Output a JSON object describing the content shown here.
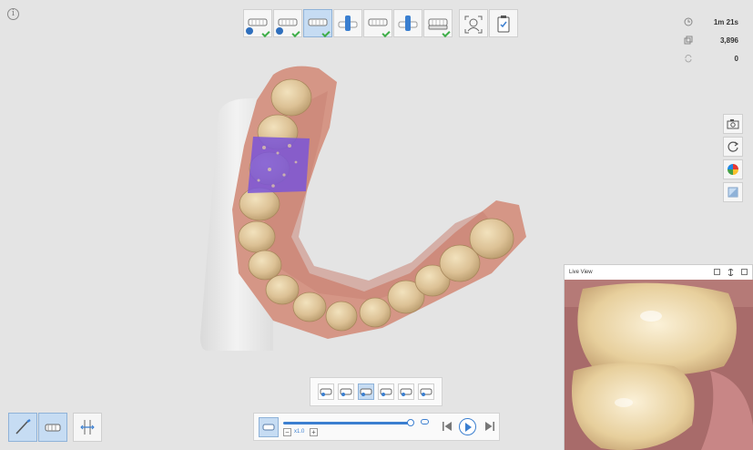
{
  "info": {
    "icon": "info-icon",
    "glyph": "i"
  },
  "stages": [
    {
      "name": "stage-maxilla-prep",
      "icon": "upper-jaw-icon",
      "done": true,
      "badge": true,
      "active": false
    },
    {
      "name": "stage-maxilla",
      "icon": "upper-jaw-icon",
      "done": true,
      "badge": true,
      "active": false
    },
    {
      "name": "stage-mandible",
      "icon": "lower-jaw-icon",
      "done": true,
      "badge": false,
      "active": true
    },
    {
      "name": "stage-scanbody-upper",
      "icon": "scanbody-icon",
      "done": false,
      "badge": false,
      "active": false
    },
    {
      "name": "stage-mandible-2",
      "icon": "lower-jaw-icon",
      "done": true,
      "badge": false,
      "active": false
    },
    {
      "name": "stage-scanbody-lower",
      "icon": "scanbody-icon",
      "done": false,
      "badge": false,
      "active": false
    },
    {
      "name": "stage-occlusion",
      "icon": "bite-icon",
      "done": true,
      "badge": false,
      "active": false
    },
    {
      "name": "stage-face-scan",
      "icon": "face-scan-icon",
      "done": false,
      "badge": false,
      "active": false
    },
    {
      "name": "stage-review",
      "icon": "clipboard-check-icon",
      "done": false,
      "badge": false,
      "active": false
    }
  ],
  "stats": {
    "time": {
      "icon": "clock-icon",
      "value": "1m 21s"
    },
    "frames": {
      "icon": "frames-icon",
      "value": "3,896"
    },
    "other": {
      "icon": "sync-icon",
      "value": "0"
    }
  },
  "side_tools": [
    {
      "name": "screenshot-button",
      "icon": "camera-icon"
    },
    {
      "name": "reset-view-button",
      "icon": "rotate-icon"
    },
    {
      "name": "color-mode-button",
      "icon": "color-wheel-icon"
    },
    {
      "name": "texture-toggle-button",
      "icon": "cube-shading-icon"
    }
  ],
  "live_view": {
    "title": "Live View"
  },
  "scan_modes": [
    {
      "name": "mode-upper",
      "icon": "upper-scan-icon",
      "active": false
    },
    {
      "name": "mode-lower",
      "icon": "lower-scan-icon",
      "active": false
    },
    {
      "name": "mode-full",
      "icon": "full-arch-icon",
      "active": true
    },
    {
      "name": "mode-bite",
      "icon": "bite-scan-icon",
      "active": false
    },
    {
      "name": "mode-left",
      "icon": "left-scan-icon",
      "active": false
    },
    {
      "name": "mode-right",
      "icon": "right-scan-icon",
      "active": false
    }
  ],
  "playback": {
    "zoom_label": "x1.0",
    "minus": "−",
    "plus": "+",
    "progress": 1.0
  },
  "bottom_tools": [
    {
      "name": "trim-tool-button",
      "icon": "brush-icon",
      "active": true
    },
    {
      "name": "lock-area-button",
      "icon": "tooth-lock-icon",
      "active": true
    },
    {
      "name": "align-tool-button",
      "icon": "align-icon",
      "active": false
    }
  ],
  "colors": {
    "accent": "#3b7fd0",
    "selected": "#c6dcf3",
    "check": "#3fae49",
    "gum": "#d89a8c",
    "tooth": "#e6d1a6",
    "highlight": "#7a55d8"
  }
}
